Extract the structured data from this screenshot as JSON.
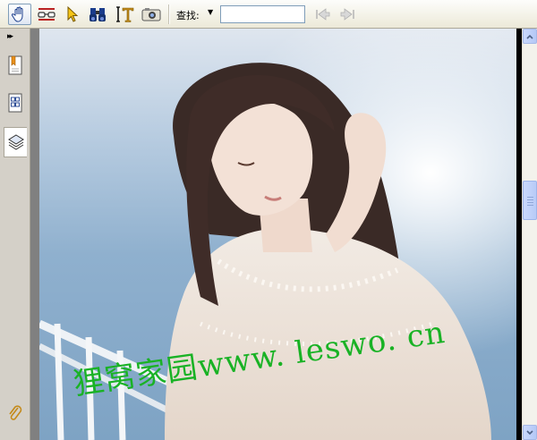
{
  "toolbar": {
    "tools": [
      {
        "icon": "hand-tool-icon",
        "active": true
      },
      {
        "icon": "reading-glasses-icon"
      },
      {
        "icon": "select-arrow-icon"
      },
      {
        "icon": "binoculars-icon"
      },
      {
        "icon": "text-select-icon"
      },
      {
        "icon": "snapshot-camera-icon"
      }
    ],
    "find_label": "查找:",
    "find_value": "",
    "find_prev_icon": "find-previous-icon",
    "find_next_icon": "find-next-icon"
  },
  "sidebar": {
    "collapse_glyph": "▸▸",
    "tabs": [
      {
        "icon": "bookmarks-icon"
      },
      {
        "icon": "pages-icon"
      },
      {
        "icon": "layers-icon",
        "active": true
      }
    ],
    "bottom_icon": "attachment-paperclip-icon"
  },
  "document": {
    "watermark": "狸窝家园www. leswo. cn",
    "watermark_color": "#19b225"
  },
  "scrollbar": {
    "position_fraction": 0.42
  }
}
